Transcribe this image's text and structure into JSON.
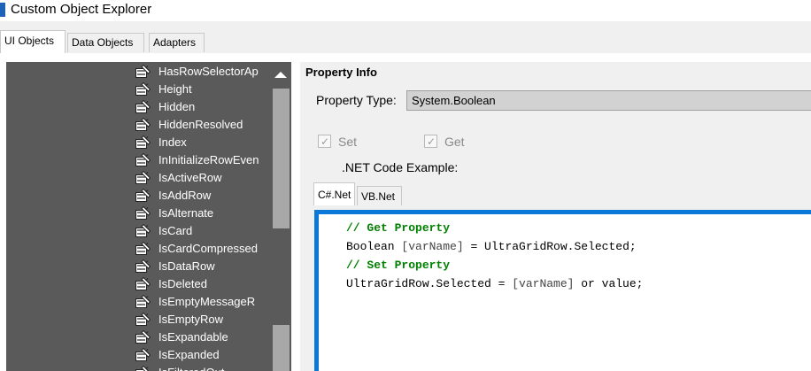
{
  "window": {
    "title": "Custom Object Explorer"
  },
  "tabs": [
    {
      "label": "UI Objects"
    },
    {
      "label": "Data Objects"
    },
    {
      "label": "Adapters"
    }
  ],
  "tree": {
    "items": [
      {
        "label": "HasRowSelectorAp"
      },
      {
        "label": "Height"
      },
      {
        "label": "Hidden"
      },
      {
        "label": "HiddenResolved"
      },
      {
        "label": "Index"
      },
      {
        "label": "InInitializeRowEven"
      },
      {
        "label": "IsActiveRow"
      },
      {
        "label": "IsAddRow"
      },
      {
        "label": "IsAlternate"
      },
      {
        "label": "IsCard"
      },
      {
        "label": "IsCardCompressed"
      },
      {
        "label": "IsDataRow"
      },
      {
        "label": "IsDeleted"
      },
      {
        "label": "IsEmptyMessageR"
      },
      {
        "label": "IsEmptyRow"
      },
      {
        "label": "IsExpandable"
      },
      {
        "label": "IsExpanded"
      },
      {
        "label": "IsFilteredOut"
      }
    ]
  },
  "property_info": {
    "title": "Property Info",
    "type_label": "Property Type:",
    "type_value": "System.Boolean",
    "set_label": "Set",
    "get_label": "Get",
    "set_checked": true,
    "get_checked": true,
    "net_label": ".NET Code Example:",
    "code_tabs": [
      {
        "label": "C#.Net"
      },
      {
        "label": "VB.Net"
      }
    ],
    "code_lines": [
      "// Get Property",
      "Boolean [varName] = UltraGridRow.Selected;",
      "// Set Property",
      "UltraGridRow.Selected = [varName] or value;"
    ]
  },
  "colors": {
    "tree_bg": "#5a5a5a",
    "code_border": "#0a78d6",
    "comment": "#008000",
    "type_box_bg": "#d2d2d2"
  },
  "icons": {
    "tree_item": "property-icon",
    "scroll_up": "scroll-up-arrow-icon",
    "check": "checkmark-icon"
  }
}
